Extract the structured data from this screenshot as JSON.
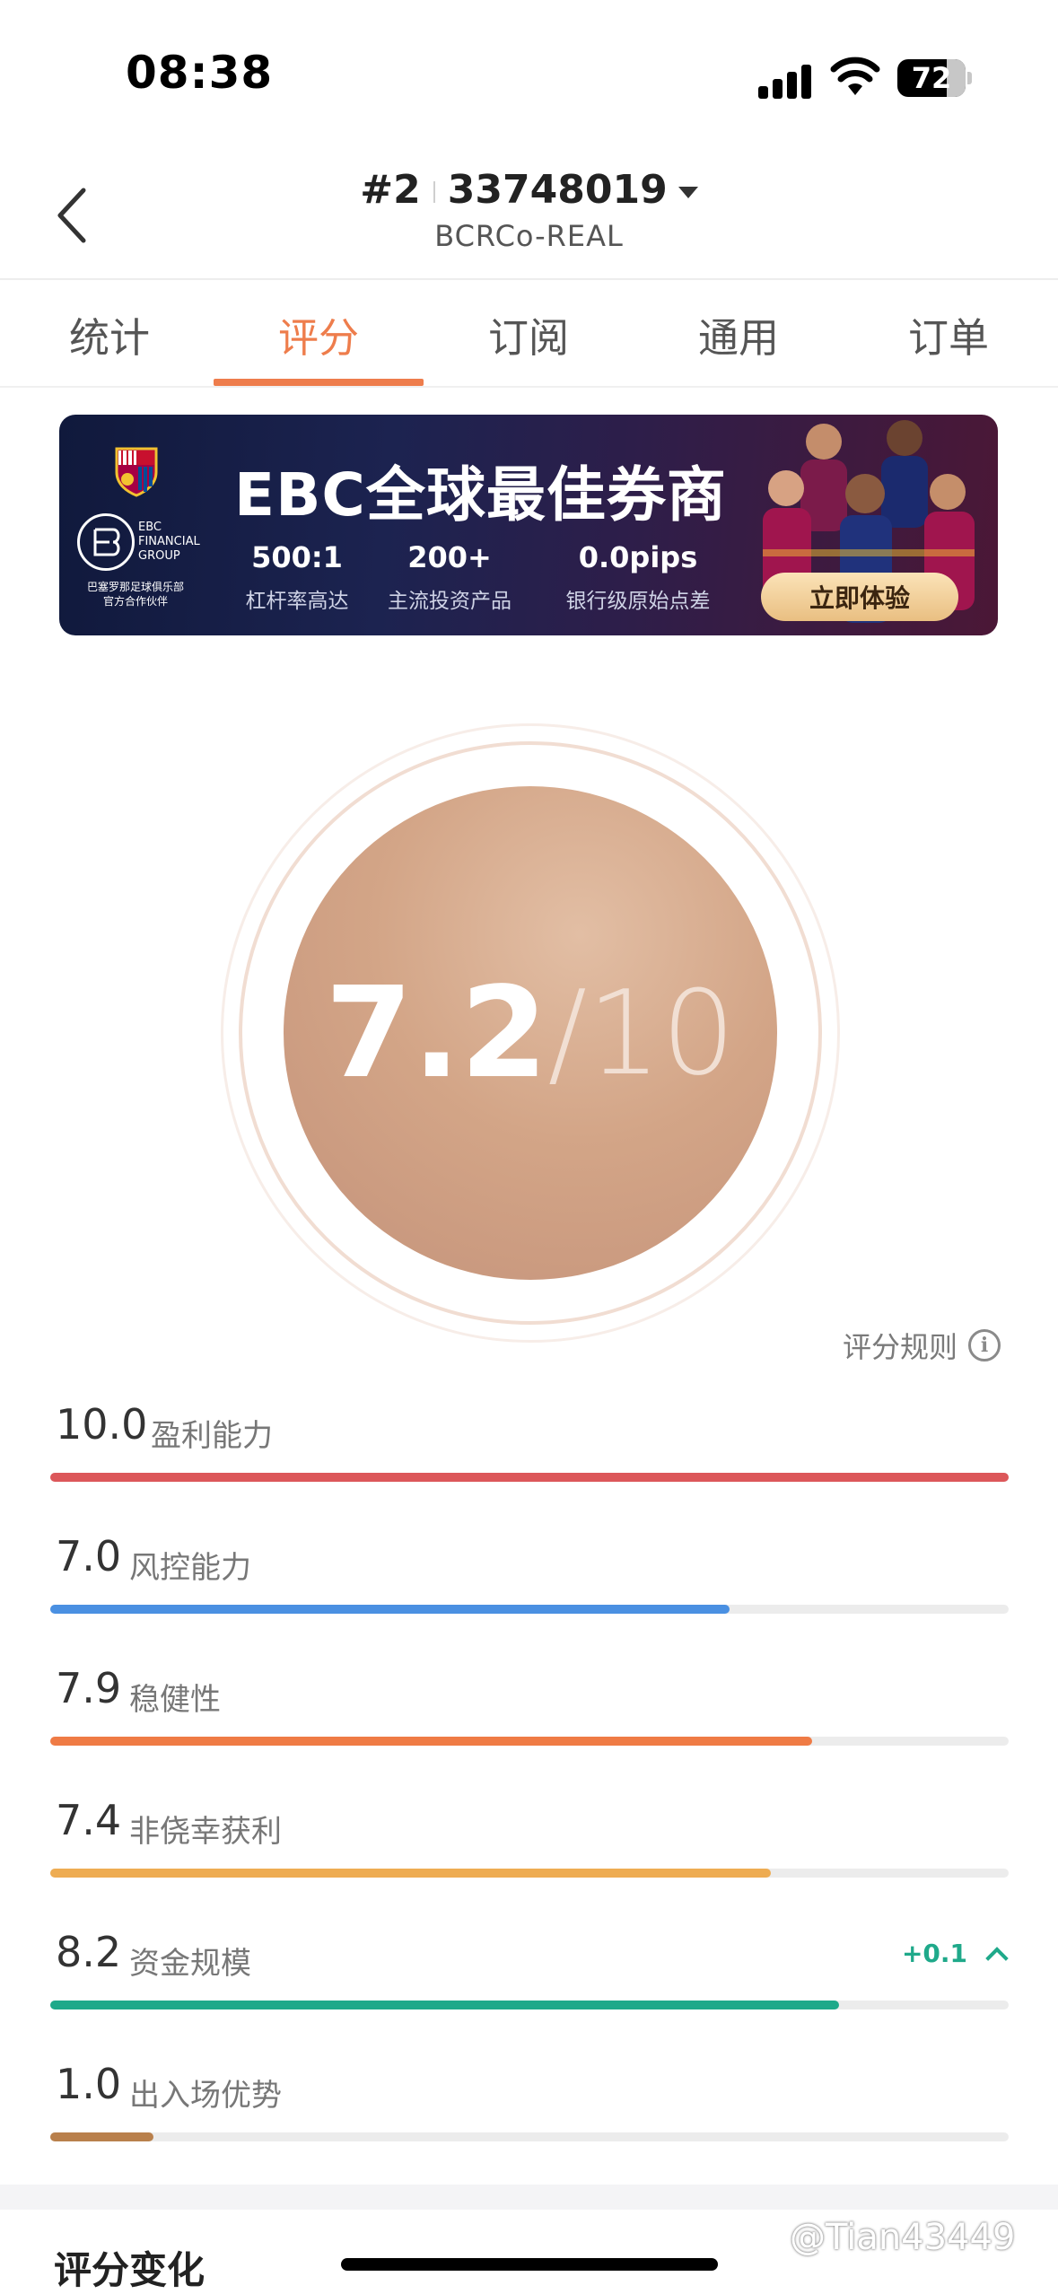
{
  "status_bar": {
    "time": "08:38",
    "battery": "72",
    "battery_level": 0.72
  },
  "header": {
    "rank": "#2",
    "account": "33748019",
    "subtitle": "BCRCo-REAL"
  },
  "tabs": [
    {
      "label": "统计"
    },
    {
      "label": "评分"
    },
    {
      "label": "订阅"
    },
    {
      "label": "通用"
    },
    {
      "label": "订单"
    }
  ],
  "active_tab": 1,
  "banner": {
    "headline": "EBC全球最佳券商",
    "logo_text": "EBC\nFINANCIAL\nGROUP",
    "partner_text": "巴塞罗那足球俱乐部\n官方合作伙伴",
    "stats": [
      {
        "value": "500:1",
        "label": "杠杆率高达"
      },
      {
        "value": "200+",
        "label": "主流投资产品"
      },
      {
        "value": "0.0pips",
        "label": "银行级原始点差"
      }
    ],
    "cta": "立即体验"
  },
  "score": {
    "value": "7.2",
    "max": "/10"
  },
  "rules_label": "评分规则",
  "metrics": [
    {
      "score": "10.0",
      "label": "盈利能力",
      "fraction": 1.0,
      "color": "#dc575a"
    },
    {
      "score": "7.0",
      "label": "风控能力",
      "fraction": 0.709,
      "color": "#4a90e2"
    },
    {
      "score": "7.9",
      "label": "稳健性",
      "fraction": 0.795,
      "color": "#ef7b45"
    },
    {
      "score": "7.4",
      "label": "非侥幸获利",
      "fraction": 0.752,
      "color": "#eeac52"
    },
    {
      "score": "8.2",
      "label": "资金规模",
      "fraction": 0.823,
      "color": "#1fa98a",
      "delta": "+0.1"
    },
    {
      "score": "1.0",
      "label": "出入场优势",
      "fraction": 0.108,
      "color": "#b9804c"
    }
  ],
  "section_title": "评分变化",
  "watermark": "@Tian43449"
}
